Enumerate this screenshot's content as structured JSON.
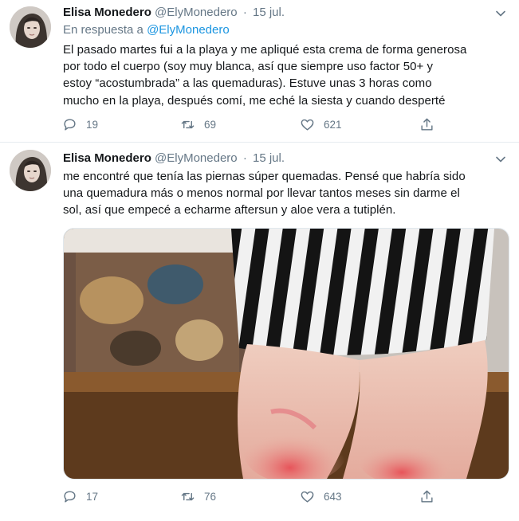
{
  "tweets": [
    {
      "author_name": "Elisa Monedero",
      "author_handle": "@ElyMonedero",
      "separator": "·",
      "date": "15 jul.",
      "reply_label": "En respuesta a",
      "reply_handle": "@ElyMonedero",
      "text_lines": [
        "El pasado martes fui a la playa y me apliqué esta crema de forma generosa",
        "por todo el cuerpo (soy muy blanca, así que siempre uso factor 50+ y",
        "estoy “acostumbrada” a las quemaduras). Estuve unas 3 horas como",
        "mucho en la playa, después comí, me eché la siesta y cuando desperté"
      ],
      "replies": "19",
      "retweets": "69",
      "likes": "621"
    },
    {
      "author_name": "Elisa Monedero",
      "author_handle": "@ElyMonedero",
      "separator": "·",
      "date": "15 jul.",
      "text_lines": [
        "me encontré que tenía las piernas súper quemadas. Pensé que habría sido",
        "una quemadura más o menos normal por llevar tantos meses sin darme el",
        "sol, así que empecé a echarme aftersun y aloe vera a tutiplén."
      ],
      "replies": "17",
      "retweets": "76",
      "likes": "643"
    }
  ],
  "icons": {
    "reply": "reply-icon",
    "retweet": "retweet-icon",
    "like": "heart-icon",
    "share": "share-icon",
    "caret": "chevron-down-icon"
  },
  "colors": {
    "text": "#14171a",
    "secondary": "#657786",
    "link": "#1b95e0",
    "divider": "#e6ecf0"
  }
}
